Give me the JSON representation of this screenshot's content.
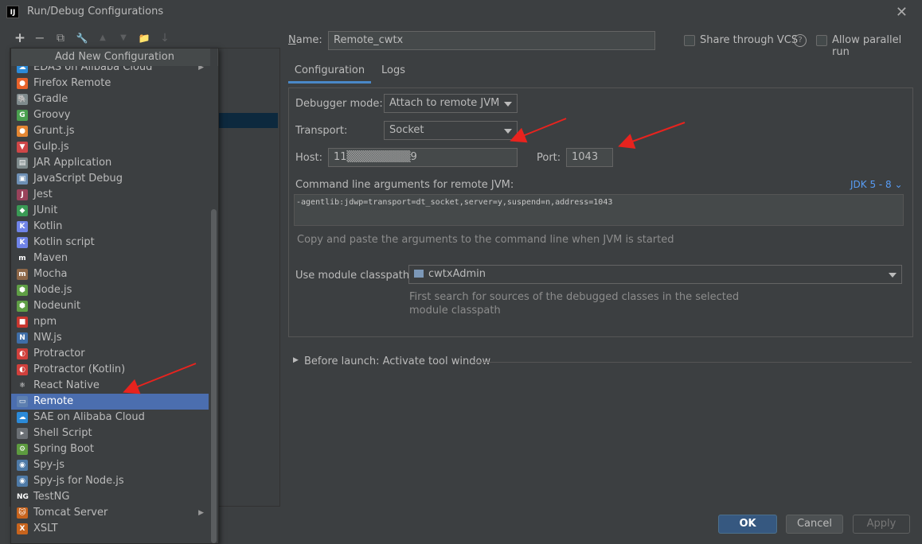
{
  "window": {
    "title": "Run/Debug Configurations",
    "app_icon_text": "IJ"
  },
  "toolbar": {
    "add": "+",
    "remove": "−",
    "copy": "⧉",
    "edit_templates": "🔧",
    "move_up": "▲",
    "move_down": "▼",
    "new_folder": "📁",
    "sort": "↓"
  },
  "popup": {
    "header": "Add New Configuration",
    "items": [
      {
        "label": "EDAS on Alibaba Cloud",
        "icon": "alibaba-cloud-icon",
        "color": "#2b8ad8",
        "glyph": "☁",
        "submenu": true
      },
      {
        "label": "Firefox Remote",
        "icon": "firefox-icon",
        "color": "#e8622a",
        "glyph": "●"
      },
      {
        "label": "Gradle",
        "icon": "gradle-icon",
        "color": "#7f8b8d",
        "glyph": "🐘"
      },
      {
        "label": "Groovy",
        "icon": "groovy-icon",
        "color": "#4aa04f",
        "glyph": "G"
      },
      {
        "label": "Grunt.js",
        "icon": "grunt-icon",
        "color": "#e48632",
        "glyph": "●"
      },
      {
        "label": "Gulp.js",
        "icon": "gulp-icon",
        "color": "#cf4647",
        "glyph": "▼"
      },
      {
        "label": "JAR Application",
        "icon": "jar-icon",
        "color": "#7f8b8d",
        "glyph": "▤"
      },
      {
        "label": "JavaScript Debug",
        "icon": "javascript-debug-icon",
        "color": "#6d8fb5",
        "glyph": "▣"
      },
      {
        "label": "Jest",
        "icon": "jest-icon",
        "color": "#99425b",
        "glyph": "J"
      },
      {
        "label": "JUnit",
        "icon": "junit-icon",
        "color": "#3a9a55",
        "glyph": "◆"
      },
      {
        "label": "Kotlin",
        "icon": "kotlin-icon",
        "color": "#6f83e8",
        "glyph": "K"
      },
      {
        "label": "Kotlin script",
        "icon": "kotlin-script-icon",
        "color": "#6f83e8",
        "glyph": "K"
      },
      {
        "label": "Maven",
        "icon": "maven-icon",
        "color": "#3c3f41",
        "glyph": "m"
      },
      {
        "label": "Mocha",
        "icon": "mocha-icon",
        "color": "#8d6748",
        "glyph": "m"
      },
      {
        "label": "Node.js",
        "icon": "nodejs-icon",
        "color": "#5f9e45",
        "glyph": "⬢"
      },
      {
        "label": "Nodeunit",
        "icon": "nodeunit-icon",
        "color": "#5f9e45",
        "glyph": "⬢"
      },
      {
        "label": "npm",
        "icon": "npm-icon",
        "color": "#c8362f",
        "glyph": "■"
      },
      {
        "label": "NW.js",
        "icon": "nwjs-icon",
        "color": "#3f6ea8",
        "glyph": "N"
      },
      {
        "label": "Protractor",
        "icon": "protractor-icon",
        "color": "#d0403c",
        "glyph": "◐"
      },
      {
        "label": "Protractor (Kotlin)",
        "icon": "protractor-kotlin-icon",
        "color": "#d0403c",
        "glyph": "◐"
      },
      {
        "label": "React Native",
        "icon": "react-native-icon",
        "color": "#3c3f41",
        "glyph": "⚛"
      },
      {
        "label": "Remote",
        "icon": "remote-icon",
        "color": "#5d7fb0",
        "glyph": "▭",
        "selected": true
      },
      {
        "label": "SAE on Alibaba Cloud",
        "icon": "sae-cloud-icon",
        "color": "#2b8ad8",
        "glyph": "☁"
      },
      {
        "label": "Shell Script",
        "icon": "shell-script-icon",
        "color": "#6b7075",
        "glyph": "▸"
      },
      {
        "label": "Spring Boot",
        "icon": "spring-boot-icon",
        "color": "#5d9b3f",
        "glyph": "⚙"
      },
      {
        "label": "Spy-js",
        "icon": "spy-js-icon",
        "color": "#4e7aa7",
        "glyph": "◉"
      },
      {
        "label": "Spy-js for Node.js",
        "icon": "spy-js-node-icon",
        "color": "#4e7aa7",
        "glyph": "◉"
      },
      {
        "label": "TestNG",
        "icon": "testng-icon",
        "color": "#3c3f41",
        "glyph": "NG"
      },
      {
        "label": "Tomcat Server",
        "icon": "tomcat-icon",
        "color": "#c8641d",
        "glyph": "🐱",
        "submenu": true
      },
      {
        "label": "XSLT",
        "icon": "xslt-icon",
        "color": "#c8641d",
        "glyph": "X"
      }
    ]
  },
  "header_fields": {
    "name_label": "Name:",
    "name_value": "Remote_cwtx",
    "share_vcs": "Share through VCS",
    "help": "?",
    "allow_parallel": "Allow parallel run"
  },
  "tabs": {
    "configuration": "Configuration",
    "logs": "Logs"
  },
  "config": {
    "debugger_mode_label": "Debugger mode:",
    "debugger_mode_value": "Attach to remote JVM",
    "transport_label": "Transport:",
    "transport_value": "Socket",
    "host_label": "Host:",
    "host_value": "11▒▒▒▒▒▒▒▒9",
    "port_label": "Port:",
    "port_value": "1043",
    "cmd_args_label": "Command line arguments for remote JVM:",
    "jdk_version": "JDK 5 - 8",
    "cmd_args_value": "-agentlib:jdwp=transport=dt_socket,server=y,suspend=n,address=1043",
    "cmd_args_hint": "Copy and paste the arguments to the command line when JVM is started",
    "module_classpath_label": "Use module classpath:",
    "module_classpath_value": "cwtxAdmin",
    "module_hint_line1": "First search for sources of the debugged classes in the selected",
    "module_hint_line2": "module classpath"
  },
  "before_launch": "Before launch: Activate tool window",
  "buttons": {
    "ok": "OK",
    "cancel": "Cancel",
    "apply": "Apply"
  },
  "annotations": {
    "arrow_color": "#e8231e"
  }
}
